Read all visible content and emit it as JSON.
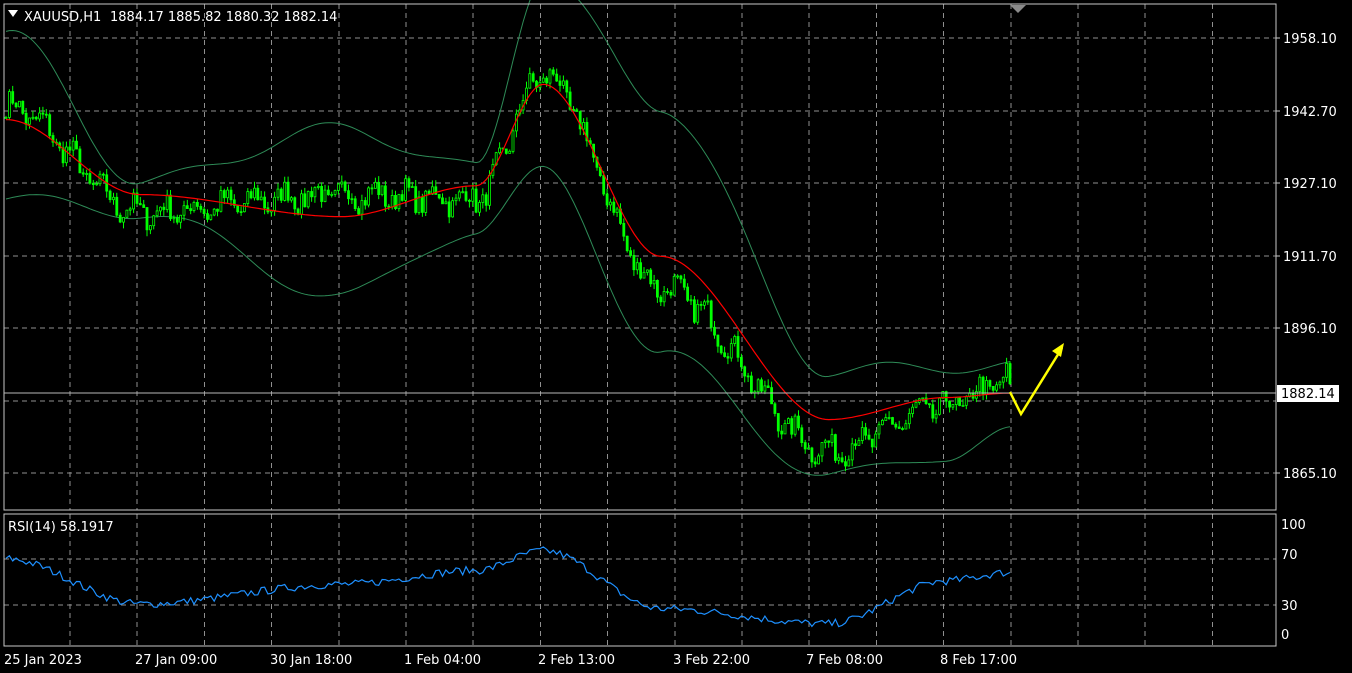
{
  "header": {
    "symbol_label": "XAUUSD,H1",
    "ohlc_label": "1884.17 1885.82 1880.32 1882.14"
  },
  "price_panel": {
    "price_ticks": [
      "1958.10",
      "1942.70",
      "1927.10",
      "1911.70",
      "1896.10",
      "1882.14",
      "1865.10"
    ],
    "current_price": "1882.14",
    "current_price_value": 1882.14
  },
  "rsi_panel": {
    "label": "RSI(14) 58.1917",
    "level_ticks": [
      "100",
      "70",
      "30",
      "0"
    ]
  },
  "time_axis": {
    "labels": [
      "25 Jan 2023",
      "27 Jan 09:00",
      "30 Jan 18:00",
      "1 Feb 04:00",
      "2 Feb 13:00",
      "3 Feb 22:00",
      "7 Feb 08:00",
      "8 Feb 17:00"
    ]
  },
  "colors": {
    "background": "#000000",
    "candles": "#00ff00",
    "moving_average": "#ff0000",
    "bollinger_bands": "#2e8b57",
    "rsi_line": "#1e90ff",
    "arrow": "#ffff00",
    "grid": "#8f8f8f",
    "text": "#ffffff"
  },
  "chart_data": [
    {
      "type": "line",
      "name": "price",
      "ylim": [
        1853.5,
        1968.2
      ],
      "x": [
        "25 Jan 2023",
        "27 Jan 09:00",
        "30 Jan 18:00",
        "1 Feb 04:00",
        "2 Feb 13:00",
        "3 Feb 22:00",
        "7 Feb 08:00",
        "8 Feb 17:00"
      ],
      "series": [
        {
          "values": [
            1945,
            1921,
            1925,
            1924,
            1952,
            1904,
            1867,
            1877,
            1883
          ]
        },
        {
          "values": [
            1942,
            1925,
            1920,
            1927,
            1950,
            1911,
            1874,
            1879,
            1880
          ]
        },
        {
          "values": [
            1962,
            1928,
            1940,
            1931,
            1975,
            1945,
            1885,
            1886,
            1886
          ]
        },
        {
          "values": [
            1924,
            1921,
            1902,
            1917,
            1930,
            1889,
            1861,
            1866,
            1871
          ]
        }
      ],
      "grid": true
    },
    {
      "type": "line",
      "name": "RSI(14)",
      "ylim": [
        0,
        100
      ],
      "value": 58.1917,
      "series": [
        {
          "values": [
            70,
            31,
            48,
            60,
            77,
            27,
            14,
            51,
            58.19
          ]
        }
      ],
      "grid": true
    }
  ]
}
